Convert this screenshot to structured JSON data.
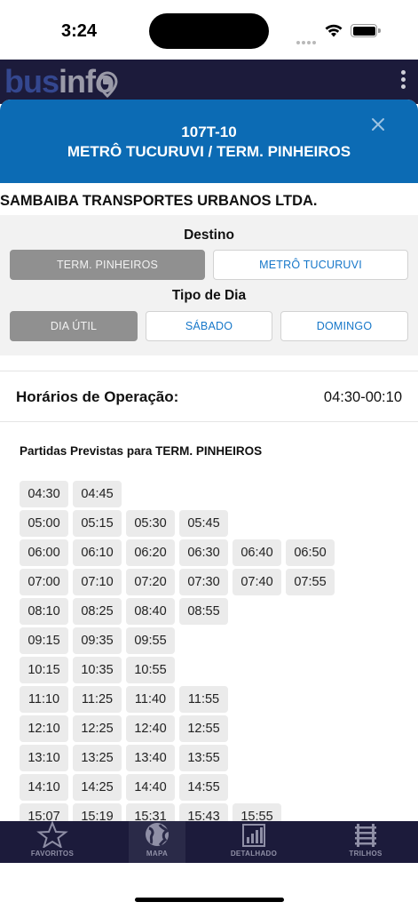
{
  "status_bar": {
    "time": "3:24"
  },
  "app_header": {
    "logo_part1": "bus",
    "logo_part2": "info"
  },
  "modal": {
    "route_code": "107T-10",
    "route_name": "METRÔ TUCURUVI / TERM. PINHEIROS",
    "company": "SAMBAIBA TRANSPORTES URBANOS LTDA.",
    "destination_label": "Destino",
    "destinations": [
      {
        "label": "TERM. PINHEIROS",
        "selected": true
      },
      {
        "label": "METRÔ TUCURUVI",
        "selected": false
      }
    ],
    "day_type_label": "Tipo de Dia",
    "day_types": [
      {
        "label": "DIA ÚTIL",
        "selected": true
      },
      {
        "label": "SÁBADO",
        "selected": false
      },
      {
        "label": "DOMINGO",
        "selected": false
      }
    ],
    "operation_hours_label": "Horários de Operação:",
    "operation_hours_value": "04:30-00:10",
    "departures_title": "Partidas Previstas para TERM. PINHEIROS",
    "departure_rows": [
      [
        "04:30",
        "04:45"
      ],
      [
        "05:00",
        "05:15",
        "05:30",
        "05:45"
      ],
      [
        "06:00",
        "06:10",
        "06:20",
        "06:30",
        "06:40",
        "06:50"
      ],
      [
        "07:00",
        "07:10",
        "07:20",
        "07:30",
        "07:40",
        "07:55"
      ],
      [
        "08:10",
        "08:25",
        "08:40",
        "08:55"
      ],
      [
        "09:15",
        "09:35",
        "09:55"
      ],
      [
        "10:15",
        "10:35",
        "10:55"
      ],
      [
        "11:10",
        "11:25",
        "11:40",
        "11:55"
      ],
      [
        "12:10",
        "12:25",
        "12:40",
        "12:55"
      ],
      [
        "13:10",
        "13:25",
        "13:40",
        "13:55"
      ],
      [
        "14:10",
        "14:25",
        "14:40",
        "14:55"
      ],
      [
        "15:07",
        "15:19",
        "15:31",
        "15:43",
        "15:55"
      ]
    ]
  },
  "tab_bar": {
    "tabs": [
      {
        "label": "FAVORITOS",
        "icon": "star-icon",
        "active": false
      },
      {
        "label": "MAPA",
        "icon": "globe-icon",
        "active": true
      },
      {
        "label": "DETALHADO",
        "icon": "chart-icon",
        "active": false
      },
      {
        "label": "TRILHOS",
        "icon": "rail-icon",
        "active": false
      }
    ]
  },
  "colors": {
    "header_navy": "#1c1b3b",
    "modal_blue": "#0c6bb4",
    "link_blue": "#1677c9",
    "selected_gray": "#909090"
  }
}
